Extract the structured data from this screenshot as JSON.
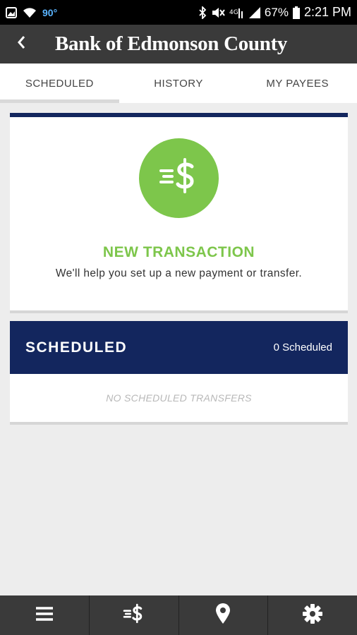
{
  "status_bar": {
    "temperature": "90°",
    "battery": "67%",
    "time": "2:21 PM"
  },
  "app_bar": {
    "title": "Bank of Edmonson County",
    "back_icon": "chevron-left-icon"
  },
  "tabs": [
    {
      "label": "SCHEDULED",
      "active": true
    },
    {
      "label": "HISTORY",
      "active": false
    },
    {
      "label": "MY PAYEES",
      "active": false
    }
  ],
  "new_transaction": {
    "icon": "money-transfer-icon",
    "title": "NEW TRANSACTION",
    "subtitle": "We'll help you set up a new payment or transfer."
  },
  "scheduled": {
    "title": "SCHEDULED",
    "count": "0 Scheduled",
    "empty_text": "NO SCHEDULED TRANSFERS"
  },
  "bottom_nav": [
    {
      "icon": "menu-icon"
    },
    {
      "icon": "transfer-icon"
    },
    {
      "icon": "location-pin-icon"
    },
    {
      "icon": "gear-icon"
    }
  ],
  "colors": {
    "navy": "#13265e",
    "green": "#7dc64b",
    "appbar": "#3a3a3a"
  }
}
